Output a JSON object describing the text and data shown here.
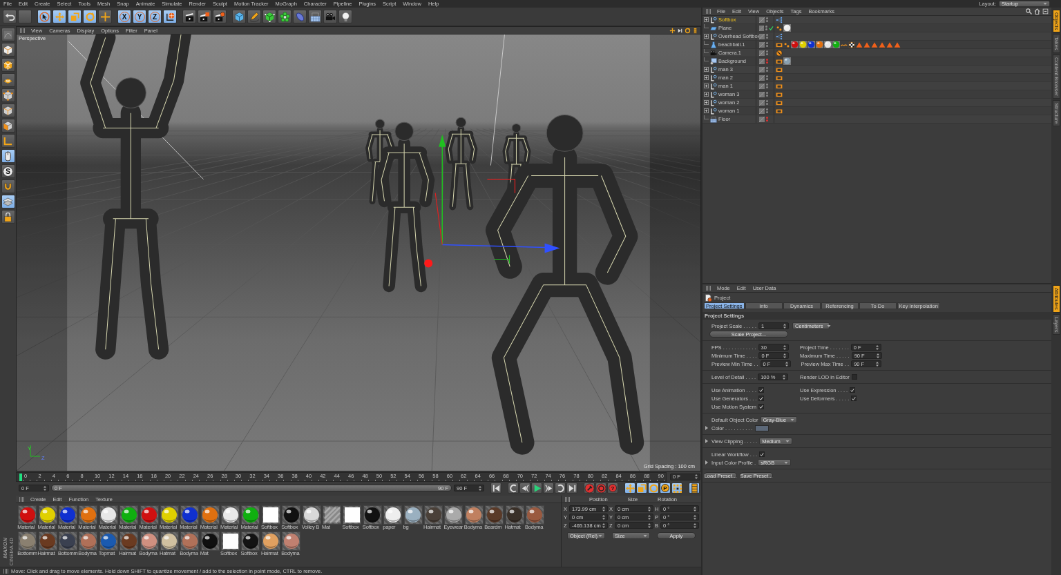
{
  "menu_bar": {
    "items": [
      "File",
      "Edit",
      "Create",
      "Select",
      "Tools",
      "Mesh",
      "Snap",
      "Animate",
      "Simulate",
      "Render",
      "Sculpt",
      "Motion Tracker",
      "MoGraph",
      "Character",
      "Pipeline",
      "Plugins",
      "Script",
      "Window",
      "Help"
    ],
    "layout_label": "Layout:",
    "layout_value": "Startup"
  },
  "toolbar": [
    {
      "kind": "undo",
      "active": false
    },
    {
      "kind": "blank",
      "active": false
    },
    {
      "kind": "select",
      "active": true
    },
    {
      "kind": "move",
      "active": true
    },
    {
      "kind": "scale",
      "active": true
    },
    {
      "kind": "rotate",
      "active": true
    },
    {
      "kind": "add",
      "active": false
    },
    {
      "kind": "axis",
      "glyph": "X",
      "active": true
    },
    {
      "kind": "axis",
      "glyph": "Y",
      "active": true
    },
    {
      "kind": "axis",
      "glyph": "Z",
      "active": true
    },
    {
      "kind": "world",
      "active": true
    },
    {
      "kind": "render-view",
      "active": false
    },
    {
      "kind": "render-picture",
      "active": false
    },
    {
      "kind": "render-settings",
      "active": false
    },
    {
      "kind": "cube",
      "active": false
    },
    {
      "kind": "pen",
      "active": false
    },
    {
      "kind": "subdivision",
      "active": false
    },
    {
      "kind": "cloner",
      "active": false
    },
    {
      "kind": "deformer",
      "active": false
    },
    {
      "kind": "floor",
      "active": false
    },
    {
      "kind": "camera",
      "active": false
    },
    {
      "kind": "light",
      "active": false
    }
  ],
  "left_toolbar": [
    {
      "kind": "model",
      "active": false
    },
    {
      "kind": "object-mode",
      "active": false
    },
    {
      "kind": "texture-mode",
      "active": false
    },
    {
      "kind": "workplane",
      "active": false
    },
    {
      "kind": "points",
      "active": false
    },
    {
      "kind": "edges",
      "active": false
    },
    {
      "kind": "polygons",
      "active": false
    },
    {
      "kind": "axis-mode",
      "active": false
    },
    {
      "kind": "tweak",
      "active": true
    },
    {
      "kind": "snap",
      "glyph": "S",
      "active": false
    },
    {
      "kind": "magnet",
      "active": false
    },
    {
      "kind": "grid",
      "active": true
    },
    {
      "kind": "lock",
      "active": false
    }
  ],
  "logo": {
    "brand": "MAXON",
    "product": "CINEMA 4D"
  },
  "viewport": {
    "menu": [
      "View",
      "Cameras",
      "Display",
      "Options",
      "Filter",
      "Panel"
    ],
    "camera_label": "Perspective",
    "grid_spacing": "Grid Spacing : 100 cm",
    "axis_labels": [
      "Y",
      "Z"
    ]
  },
  "timeline": {
    "ticks": [
      "0",
      "2",
      "4",
      "6",
      "8",
      "10",
      "12",
      "14",
      "16",
      "18",
      "20",
      "22",
      "24",
      "26",
      "28",
      "30",
      "32",
      "34",
      "36",
      "38",
      "40",
      "42",
      "44",
      "46",
      "48",
      "50",
      "52",
      "54",
      "56",
      "58",
      "60",
      "62",
      "64",
      "66",
      "68",
      "70",
      "72",
      "74",
      "76",
      "78",
      "80",
      "82",
      "84",
      "86",
      "88",
      "90"
    ],
    "playhead": {
      "level": 0
    },
    "current_frame": "0 F",
    "start_field": "0 F",
    "range_start": "0 F",
    "range_end": "90 F",
    "range": {
      "level": 1
    },
    "end_field": "90 F",
    "controls": [
      {
        "kind": "go-start",
        "active": false
      },
      {
        "kind": "prev-key",
        "active": false
      },
      {
        "kind": "prev-frame",
        "active": false
      },
      {
        "kind": "play",
        "active": false
      },
      {
        "kind": "next-frame",
        "active": false
      },
      {
        "kind": "next-key",
        "active": false
      },
      {
        "kind": "go-end",
        "active": false
      },
      {
        "kind": "record",
        "active": false
      },
      {
        "kind": "autokey",
        "active": false
      },
      {
        "kind": "key-selection",
        "glyph": "?",
        "active": false
      },
      {
        "kind": "key-position",
        "active": true
      },
      {
        "kind": "key-scale",
        "active": true
      },
      {
        "kind": "key-rotation",
        "active": true
      },
      {
        "kind": "key-parameter",
        "glyph": "P",
        "active": true
      },
      {
        "kind": "key-point",
        "active": true
      },
      {
        "kind": "timeline-window",
        "active": true
      }
    ]
  },
  "materials": {
    "menu": [
      "Create",
      "Edit",
      "Function",
      "Texture"
    ],
    "items": [
      {
        "name": "Material",
        "kind": "sphere",
        "color": "#d01010"
      },
      {
        "name": "Material",
        "kind": "sphere",
        "color": "#e0d000"
      },
      {
        "name": "Material",
        "kind": "sphere",
        "color": "#1030d0"
      },
      {
        "name": "Material",
        "kind": "sphere",
        "color": "#e07010"
      },
      {
        "name": "Material",
        "kind": "sphere",
        "color": "#e8e8e8"
      },
      {
        "name": "Material",
        "kind": "sphere",
        "color": "#10b010"
      },
      {
        "name": "Material",
        "kind": "sphere",
        "color": "#d01010"
      },
      {
        "name": "Material",
        "kind": "sphere",
        "color": "#e0d000"
      },
      {
        "name": "Material",
        "kind": "sphere",
        "color": "#1030d0"
      },
      {
        "name": "Material",
        "kind": "sphere",
        "color": "#e07010"
      },
      {
        "name": "Material",
        "kind": "sphere",
        "color": "#e8e8e8"
      },
      {
        "name": "Material",
        "kind": "sphere",
        "color": "#10b010"
      },
      {
        "name": "Softbox",
        "kind": "flat",
        "color": "#ffffff"
      },
      {
        "name": "Softbox",
        "kind": "sphere",
        "color": "#111111"
      },
      {
        "name": "Volley B",
        "kind": "sphere",
        "color": "#d8d8d8"
      },
      {
        "name": "Mat",
        "kind": "striped",
        "color": "#888888"
      },
      {
        "name": "Softbox",
        "kind": "flat",
        "color": "#fefefe"
      },
      {
        "name": "Softbox",
        "kind": "sphere",
        "color": "#121212"
      },
      {
        "name": "paper",
        "kind": "sphere",
        "color": "#eeeeee"
      },
      {
        "name": "bg",
        "kind": "sphere",
        "color": "#9ab0c0"
      },
      {
        "name": "Hairmat",
        "kind": "sphere",
        "color": "#4a4038"
      },
      {
        "name": "Eyewear",
        "kind": "sphere",
        "color": "#aaaaaa"
      },
      {
        "name": "Bodyma",
        "kind": "sphere",
        "color": "#c08060"
      },
      {
        "name": "Beardm",
        "kind": "sphere",
        "color": "#5a3a28"
      },
      {
        "name": "Hatmat",
        "kind": "sphere",
        "color": "#3a3028"
      },
      {
        "name": "Bodyma",
        "kind": "sphere",
        "color": "#9a5a40"
      },
      {
        "name": "Bottomm",
        "kind": "sphere",
        "color": "#8a8070"
      },
      {
        "name": "Hairmat",
        "kind": "sphere",
        "color": "#6a3a20"
      },
      {
        "name": "Bottomm",
        "kind": "sphere",
        "color": "#3a4050"
      },
      {
        "name": "Bodyma",
        "kind": "sphere",
        "color": "#b07058"
      },
      {
        "name": "Topmat",
        "kind": "sphere",
        "color": "#1a5ab0"
      },
      {
        "name": "Hairmat",
        "kind": "sphere",
        "color": "#6b3b21"
      },
      {
        "name": "Bodyma",
        "kind": "sphere",
        "color": "#d09080"
      },
      {
        "name": "Hatmat",
        "kind": "sphere",
        "color": "#d0c0a0"
      },
      {
        "name": "Bodyma",
        "kind": "sphere",
        "color": "#b17159"
      },
      {
        "name": "Mat",
        "kind": "sphere",
        "color": "#101010"
      },
      {
        "name": "Softbox",
        "kind": "flat",
        "color": "#fdfdfd"
      },
      {
        "name": "Softbox",
        "kind": "sphere",
        "color": "#131313"
      },
      {
        "name": "Hairmat",
        "kind": "sphere",
        "color": "#e0a060"
      },
      {
        "name": "Bodyma",
        "kind": "sphere",
        "color": "#c08070"
      }
    ]
  },
  "coordinates": {
    "headers": [
      "Position",
      "Size",
      "Rotation"
    ],
    "rows": [
      {
        "axis": "X",
        "position": "173.99 cm",
        "size_axis": "X",
        "size": "0 cm",
        "rotation_axis": "H",
        "rotation": "0 °"
      },
      {
        "axis": "Y",
        "position": "0 cm",
        "size_axis": "Y",
        "size": "0 cm",
        "rotation_axis": "P",
        "rotation": "0 °"
      },
      {
        "axis": "Z",
        "position": "-465.138 cm",
        "size_axis": "Z",
        "size": "0 cm",
        "rotation_axis": "B",
        "rotation": "0 °"
      }
    ],
    "mode": "Object (Rel)",
    "size_mode": "Size",
    "apply": "Apply"
  },
  "status_bar": "Move: Click and drag to move elements. Hold down SHIFT to quantize movement / add to the selection in point mode, CTRL to remove.",
  "objects": {
    "menu": [
      "File",
      "Edit",
      "View",
      "Objects",
      "Tags",
      "Bookmarks"
    ],
    "items": [
      {
        "name": "Softbox",
        "kind": "null",
        "toggle": true,
        "selected": true,
        "check": false,
        "render_off": false,
        "tags": [
          {
            "kind": "nodes"
          }
        ]
      },
      {
        "name": "Plane",
        "kind": "plane",
        "toggle": false,
        "selected": false,
        "check": true,
        "render_off": false,
        "tags": [
          {
            "kind": "phong"
          },
          {
            "kind": "material",
            "color": "#eeeeee"
          }
        ]
      },
      {
        "name": "Overhead Softbox",
        "kind": "null",
        "toggle": true,
        "selected": false,
        "check": false,
        "render_off": false,
        "tags": [
          {
            "kind": "nodes"
          }
        ]
      },
      {
        "name": "beachball.1",
        "kind": "polygon",
        "toggle": false,
        "selected": false,
        "check": false,
        "render_off": false,
        "tags": [
          {
            "kind": "display"
          },
          {
            "kind": "phong"
          },
          {
            "kind": "material",
            "color": "#d01010"
          },
          {
            "kind": "material",
            "color": "#e0d000"
          },
          {
            "kind": "material",
            "color": "#1030d0"
          },
          {
            "kind": "material",
            "color": "#e07010"
          },
          {
            "kind": "material",
            "color": "#e8e8e8"
          },
          {
            "kind": "material",
            "color": "#10b010"
          },
          {
            "kind": "uvw"
          },
          {
            "kind": "checker"
          },
          {
            "kind": "selection"
          },
          {
            "kind": "selection"
          },
          {
            "kind": "selection"
          },
          {
            "kind": "selection"
          },
          {
            "kind": "selection"
          },
          {
            "kind": "selection"
          }
        ]
      },
      {
        "name": "Camera.1",
        "kind": "camera",
        "toggle": false,
        "selected": false,
        "check": false,
        "render_off": false,
        "tags": [
          {
            "kind": "protection"
          }
        ]
      },
      {
        "name": "Background",
        "kind": "background",
        "toggle": false,
        "selected": false,
        "check": false,
        "render_off": true,
        "tags": [
          {
            "kind": "display"
          },
          {
            "kind": "material",
            "color": "#8aa0b0"
          }
        ]
      },
      {
        "name": "man 3",
        "kind": "null",
        "toggle": true,
        "selected": false,
        "check": false,
        "render_off": false,
        "tags": [
          {
            "kind": "display"
          }
        ]
      },
      {
        "name": "man 2",
        "kind": "null",
        "toggle": true,
        "selected": false,
        "check": false,
        "render_off": false,
        "tags": [
          {
            "kind": "display"
          }
        ]
      },
      {
        "name": "man 1",
        "kind": "null",
        "toggle": true,
        "selected": false,
        "check": false,
        "render_off": false,
        "tags": [
          {
            "kind": "display"
          }
        ]
      },
      {
        "name": "woman 3",
        "kind": "null",
        "toggle": true,
        "selected": false,
        "check": false,
        "render_off": false,
        "tags": [
          {
            "kind": "display"
          }
        ]
      },
      {
        "name": "woman 2",
        "kind": "null",
        "toggle": true,
        "selected": false,
        "check": false,
        "render_off": false,
        "tags": [
          {
            "kind": "display"
          }
        ]
      },
      {
        "name": "woman 1",
        "kind": "null",
        "toggle": true,
        "selected": false,
        "check": false,
        "render_off": false,
        "tags": [
          {
            "kind": "display"
          }
        ]
      },
      {
        "name": "Floor",
        "kind": "floor",
        "toggle": false,
        "selected": false,
        "check": false,
        "render_off": true
      }
    ]
  },
  "attributes": {
    "menu": [
      "Mode",
      "Edit",
      "User Data"
    ],
    "title": "Project",
    "tabs": [
      {
        "label": "Project Settings",
        "selected": true
      },
      {
        "label": "Info",
        "selected": false
      },
      {
        "label": "Dynamics",
        "selected": false
      },
      {
        "label": "Referencing",
        "selected": false
      },
      {
        "label": "To Do",
        "selected": false
      },
      {
        "label": "Key Interpolation",
        "selected": false
      }
    ],
    "section": "Project Settings",
    "groups": [
      [
        [
          {
            "kind": "number",
            "label": "Project Scale . . . . .",
            "value": "1",
            "expandable": false
          },
          {
            "kind": "dropdown",
            "value": "Centimeters"
          }
        ],
        [
          {
            "kind": "button",
            "value": "Scale Project..."
          }
        ]
      ],
      [
        [
          {
            "kind": "number",
            "label": "FPS . . . . . . . . . . . .",
            "value": "30",
            "expandable": false
          },
          {
            "kind": "number",
            "label": "Project Time . . . . . . .",
            "value": "0 F",
            "expandable": false
          }
        ],
        [
          {
            "kind": "number",
            "label": "Minimum Time . . . .",
            "value": "0 F",
            "expandable": false
          },
          {
            "kind": "number",
            "label": "Maximum Time . . . . .",
            "value": "90 F",
            "expandable": false
          }
        ],
        [
          {
            "kind": "number",
            "label": "Preview Min Time . .",
            "value": "0 F",
            "expandable": false
          },
          {
            "kind": "number",
            "label": "Preview Max Time . .",
            "value": "90 F",
            "expandable": false
          }
        ]
      ],
      [
        [
          {
            "kind": "number",
            "label": "Level of Detail . . . .",
            "value": "100 %",
            "expandable": false
          },
          {
            "kind": "checkbox",
            "label": "Render LOD in Editor",
            "checked": false,
            "expandable": false
          }
        ]
      ],
      [
        [
          {
            "kind": "checkbox",
            "label": "Use Animation . . . .",
            "checked": true,
            "expandable": false
          },
          {
            "kind": "checkbox",
            "label": "Use Expression . . . .",
            "checked": true,
            "expandable": false
          }
        ],
        [
          {
            "kind": "checkbox",
            "label": "Use Generators . . .",
            "checked": true,
            "expandable": false
          },
          {
            "kind": "checkbox",
            "label": "Use Deformers . . . . .",
            "checked": true,
            "expandable": false
          }
        ],
        [
          {
            "kind": "checkbox",
            "label": "Use Motion System",
            "checked": true,
            "expandable": false
          }
        ]
      ],
      [
        [
          {
            "kind": "dropdown",
            "label": "Default Object Color",
            "value": "Gray-Blue",
            "expandable": false
          }
        ],
        [
          {
            "kind": "color",
            "label": "Color . . . . . . . . . .",
            "color": "#5c6878",
            "expandable": true
          }
        ]
      ],
      [
        [
          {
            "kind": "dropdown",
            "label": "View Clipping . . . . .",
            "value": "Medium",
            "expandable": true
          }
        ]
      ],
      [
        [
          {
            "kind": "checkbox",
            "label": "Linear Workflow . . .",
            "checked": true,
            "expandable": false
          }
        ],
        [
          {
            "kind": "dropdown",
            "label": "Input Color Profile .",
            "value": "sRGB",
            "expandable": true
          }
        ]
      ],
      [
        [
          {
            "kind": "button",
            "value": "Load Preset..."
          },
          {
            "kind": "button",
            "value": "Save Preset..."
          }
        ]
      ]
    ]
  },
  "side_tabs": {
    "top": [
      {
        "label": "Objects",
        "selected": true
      },
      {
        "label": "Takes",
        "selected": false
      },
      {
        "label": "Content Browser",
        "selected": false
      },
      {
        "label": "Structure",
        "selected": false
      }
    ],
    "bottom": [
      {
        "label": "Attributes",
        "selected": true
      },
      {
        "label": "Layers",
        "selected": false
      }
    ]
  }
}
